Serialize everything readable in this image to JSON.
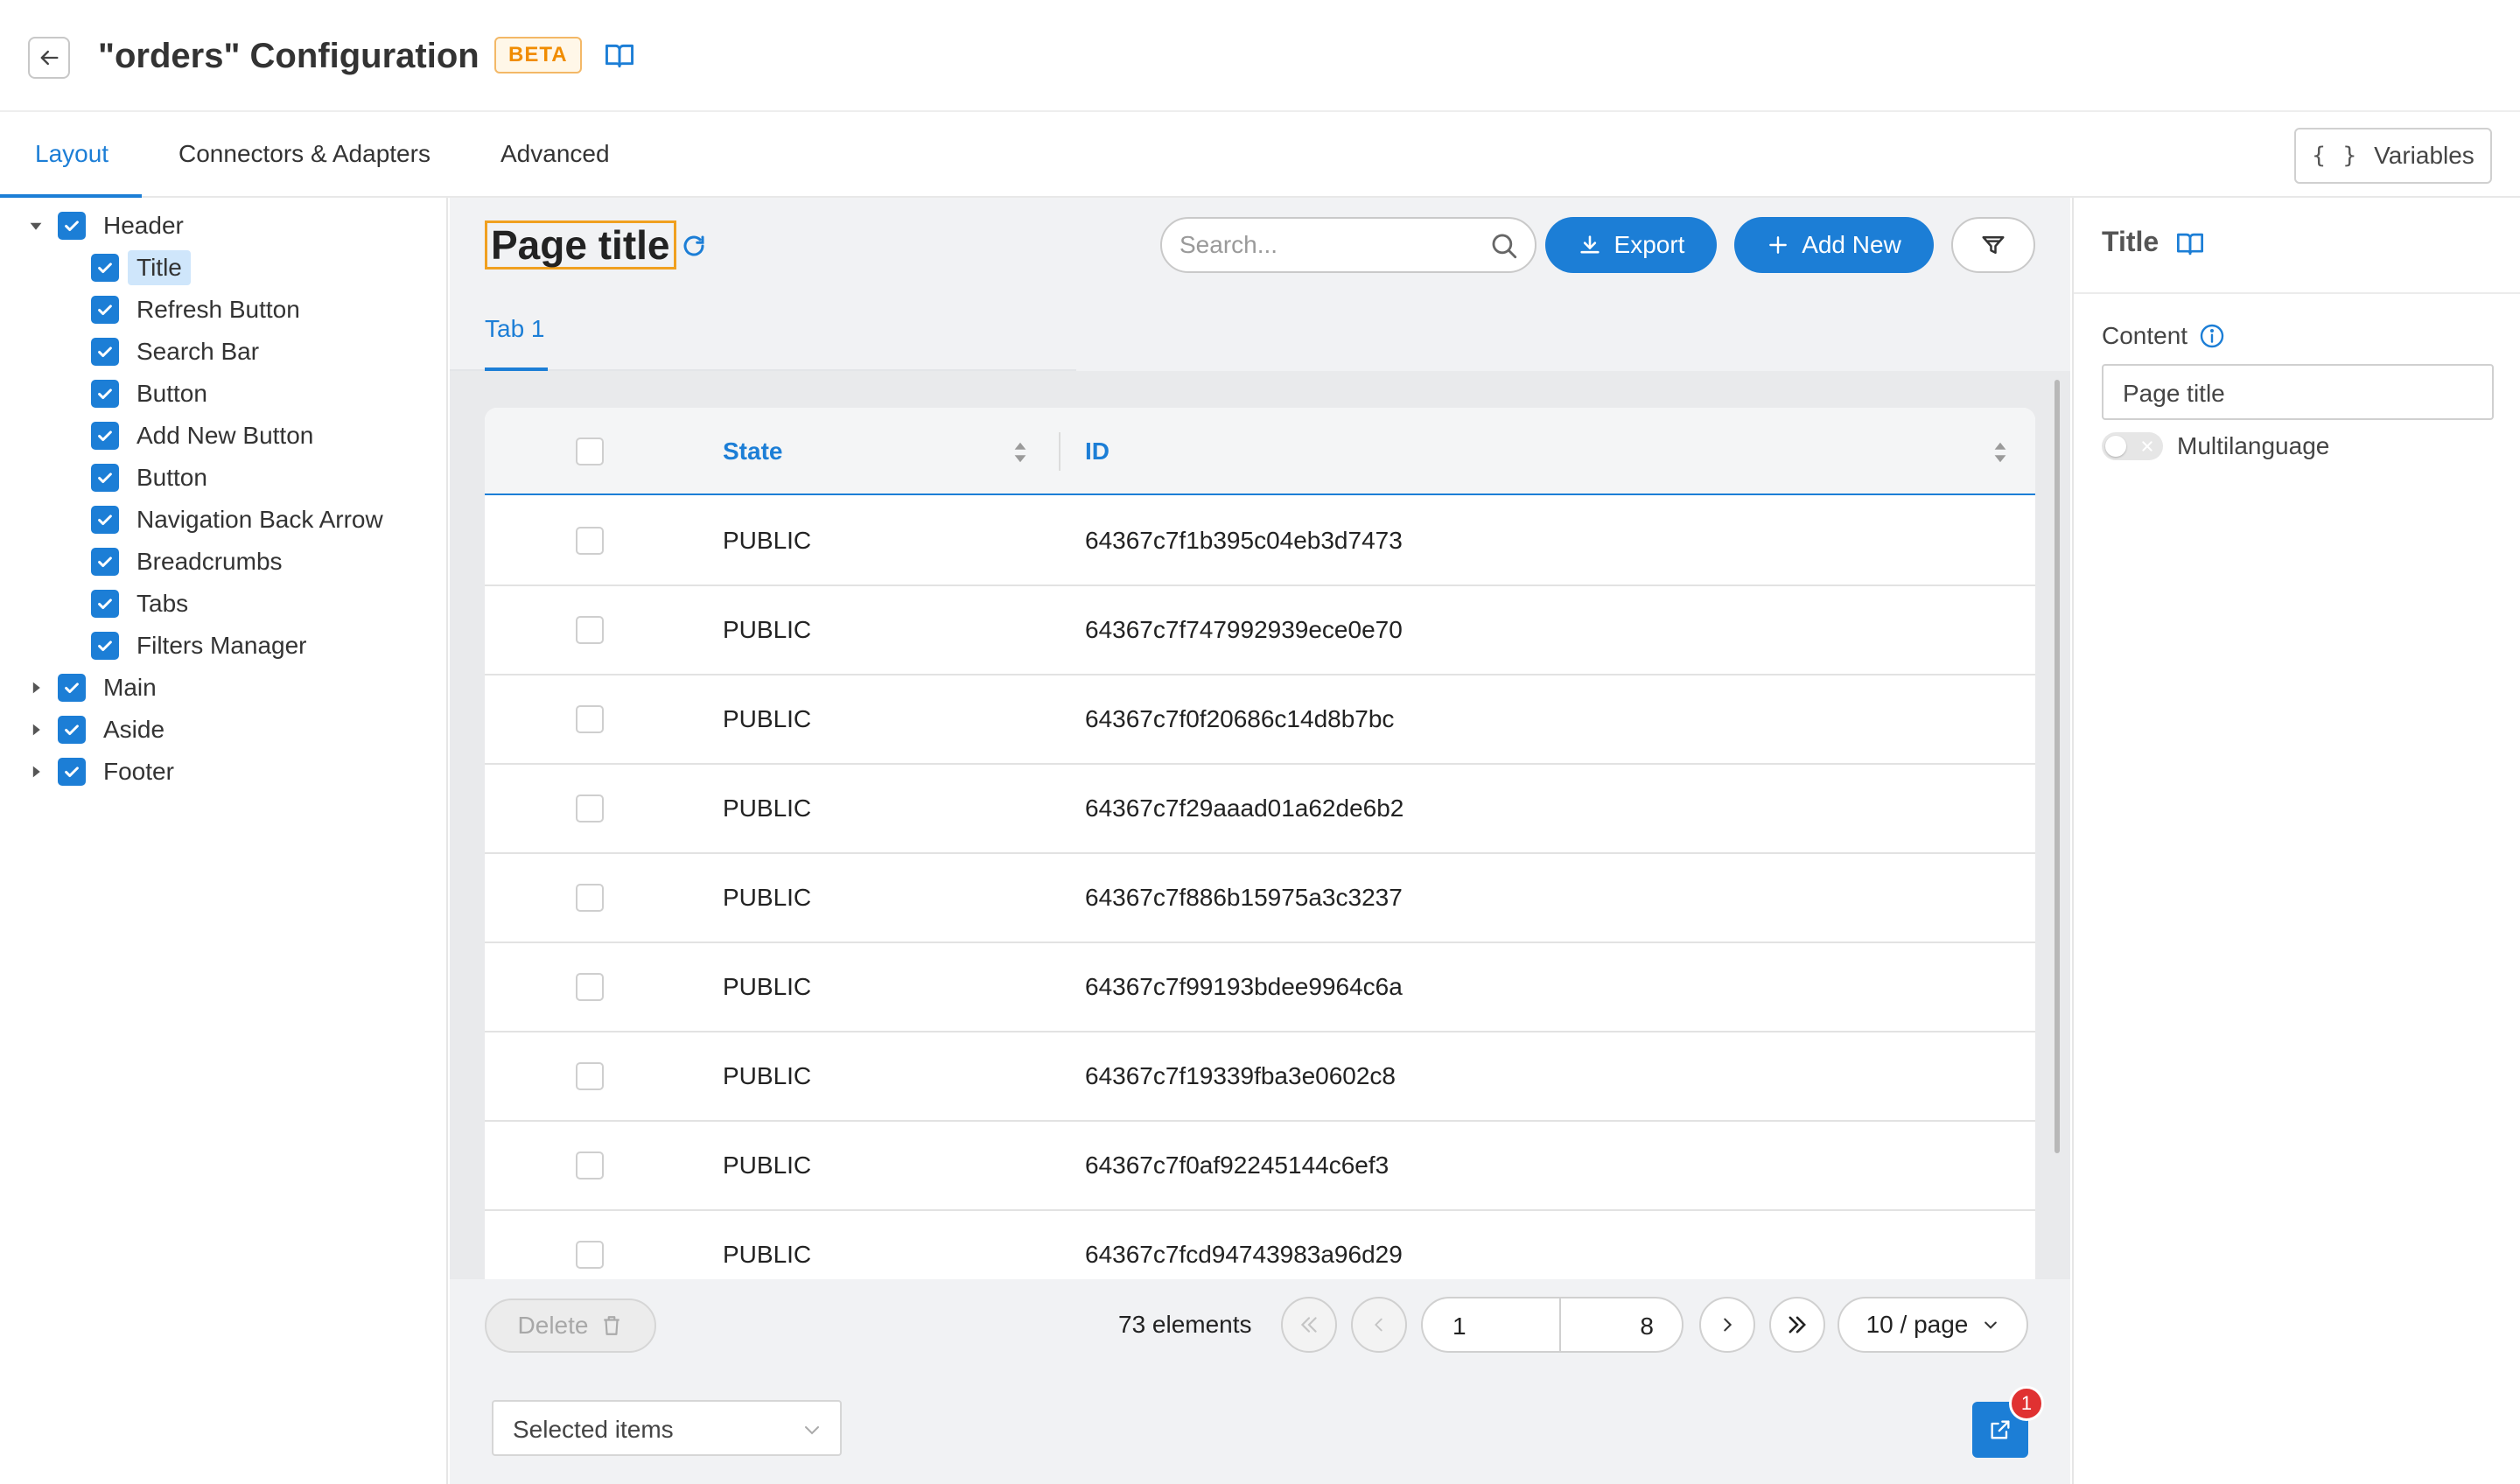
{
  "header": {
    "title": "\"orders\" Configuration",
    "badge": "BETA",
    "doc_icon": "book-icon"
  },
  "tabs": [
    {
      "label": "Layout",
      "active": true
    },
    {
      "label": "Connectors & Adapters",
      "active": false
    },
    {
      "label": "Advanced",
      "active": false
    }
  ],
  "variables_button": {
    "label": "Variables",
    "icon": "{ }"
  },
  "tree": {
    "items": [
      {
        "label": "Header",
        "level": 0,
        "expanded": true,
        "checked": true
      },
      {
        "label": "Title",
        "level": 1,
        "checked": true,
        "selected": true
      },
      {
        "label": "Refresh Button",
        "level": 1,
        "checked": true
      },
      {
        "label": "Search Bar",
        "level": 1,
        "checked": true
      },
      {
        "label": "Button",
        "level": 1,
        "checked": true
      },
      {
        "label": "Add New Button",
        "level": 1,
        "checked": true
      },
      {
        "label": "Button",
        "level": 1,
        "checked": true
      },
      {
        "label": "Navigation Back Arrow",
        "level": 1,
        "checked": true
      },
      {
        "label": "Breadcrumbs",
        "level": 1,
        "checked": true
      },
      {
        "label": "Tabs",
        "level": 1,
        "checked": true
      },
      {
        "label": "Filters Manager",
        "level": 1,
        "checked": true
      },
      {
        "label": "Main",
        "level": 0,
        "expanded": false,
        "checked": true
      },
      {
        "label": "Aside",
        "level": 0,
        "expanded": false,
        "checked": true
      },
      {
        "label": "Footer",
        "level": 0,
        "expanded": false,
        "checked": true
      }
    ]
  },
  "preview": {
    "page_title": "Page title",
    "search_placeholder": "Search...",
    "export_label": "Export",
    "add_new_label": "Add New",
    "inner_tab": "Tab 1",
    "table": {
      "columns": [
        "State",
        "ID"
      ],
      "rows": [
        {
          "state": "PUBLIC",
          "id": "64367c7f1b395c04eb3d7473"
        },
        {
          "state": "PUBLIC",
          "id": "64367c7f747992939ece0e70"
        },
        {
          "state": "PUBLIC",
          "id": "64367c7f0f20686c14d8b7bc"
        },
        {
          "state": "PUBLIC",
          "id": "64367c7f29aaad01a62de6b2"
        },
        {
          "state": "PUBLIC",
          "id": "64367c7f886b15975a3c3237"
        },
        {
          "state": "PUBLIC",
          "id": "64367c7f99193bdee9964c6a"
        },
        {
          "state": "PUBLIC",
          "id": "64367c7f19339fba3e0602c8"
        },
        {
          "state": "PUBLIC",
          "id": "64367c7f0af92245144c6ef3"
        },
        {
          "state": "PUBLIC",
          "id": "64367c7fcd94743983a96d29"
        }
      ]
    },
    "footer": {
      "delete_label": "Delete",
      "elements_count": "73 elements",
      "current_page": "1",
      "total_pages": "8",
      "per_page": "10 / page",
      "selected_items": "Selected items",
      "notification_count": "1"
    }
  },
  "right_panel": {
    "title": "Title",
    "content_label": "Content",
    "content_value": "Page title",
    "multilanguage_label": "Multilanguage"
  },
  "colors": {
    "accent": "#1c7ed6",
    "beta_badge": "#f08c00",
    "selection_outline": "#f0a020",
    "notification": "#e03131"
  }
}
